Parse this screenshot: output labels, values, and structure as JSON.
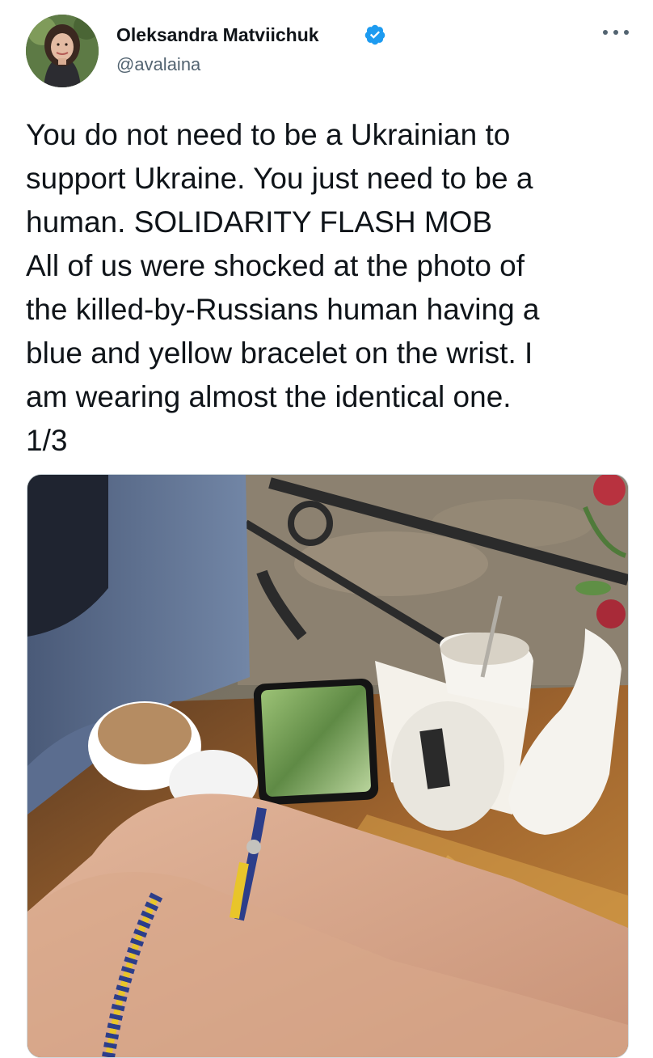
{
  "author": {
    "name": "Oleksandra Matviichuk",
    "handle": "@avalaina",
    "verified_icon": "verified-badge-icon",
    "avatar_icon": "profile-photo"
  },
  "tweet": {
    "lines": [
      "You do not need to be a Ukrainian to",
      "support Ukraine. You just need to be a",
      "human. SOLIDARITY FLASH MOB",
      "All of us were shocked at the photo of",
      "the killed-by-Russians human having a",
      "blue and yellow bracelet on the wrist. I",
      "am wearing almost the identical one.",
      "1/3"
    ]
  },
  "media": {
    "type": "photo"
  },
  "colors": {
    "verified_blue": "#1d9bf0",
    "text": "#0f1419",
    "secondary": "#536471"
  }
}
